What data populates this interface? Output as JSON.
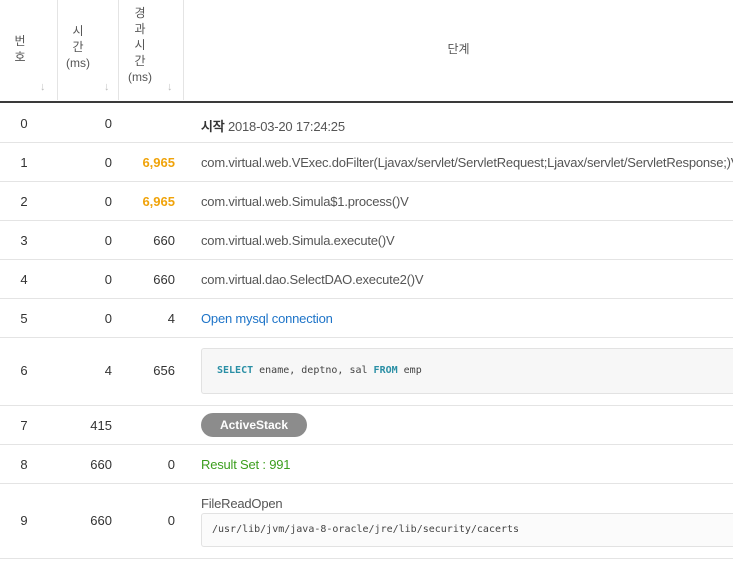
{
  "header": {
    "col_no": "번\n호",
    "col_time": "시\n간\n(ms)",
    "col_elapsed": "경\n과\n시\n간\n(ms)",
    "col_step": "단계",
    "sort_icon": "↓"
  },
  "rows": [
    {
      "no": "0",
      "time": "0",
      "elapsed": "",
      "step_bold": "시작",
      "step": "2018-03-20 17:24:25"
    },
    {
      "no": "1",
      "time": "0",
      "elapsed": "6,965",
      "step": "com.virtual.web.VExec.doFilter(Ljavax/servlet/ServletRequest;Ljavax/servlet/ServletResponse;)V"
    },
    {
      "no": "2",
      "time": "0",
      "elapsed": "6,965",
      "step": "com.virtual.web.Simula$1.process()V"
    },
    {
      "no": "3",
      "time": "0",
      "elapsed": "660",
      "step": "com.virtual.web.Simula.execute()V"
    },
    {
      "no": "4",
      "time": "0",
      "elapsed": "660",
      "step": "com.virtual.dao.SelectDAO.execute2()V"
    },
    {
      "no": "5",
      "time": "0",
      "elapsed": "4",
      "step": "Open mysql connection"
    },
    {
      "no": "6",
      "time": "4",
      "elapsed": "656",
      "sql_kw1": "SELECT",
      "sql_mid": " ename, deptno, sal ",
      "sql_kw2": "FROM",
      "sql_tail": " emp"
    },
    {
      "no": "7",
      "time": "415",
      "elapsed": "",
      "button": "ActiveStack"
    },
    {
      "no": "8",
      "time": "660",
      "elapsed": "0",
      "step": "Result Set : 991"
    },
    {
      "no": "9",
      "time": "660",
      "elapsed": "0",
      "step": "FileReadOpen",
      "path": "/usr/lib/jvm/java-8-oracle/jre/lib/security/cacerts"
    }
  ],
  "colors": {
    "hot": "#f0a30a",
    "link": "#1e74c8",
    "green": "#3c9e1e",
    "button": "#8c8c8c"
  }
}
